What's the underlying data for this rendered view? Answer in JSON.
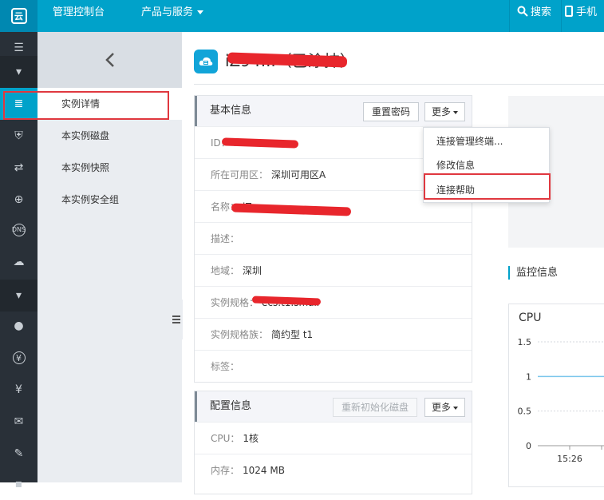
{
  "topbar": {
    "logo_text": "云",
    "console_label": "管理控制台",
    "products_label": "产品与服务",
    "search_label": "搜索",
    "phone_label": "手机",
    "bar_color": "#00a2ca"
  },
  "rail": {
    "items": [
      {
        "icon": "menu-icon",
        "glyph": "☰"
      },
      {
        "icon": "caret-down-icon",
        "glyph": "▾"
      },
      {
        "icon": "server-icon",
        "glyph": "≣"
      },
      {
        "icon": "shield-icon",
        "glyph": "⛨"
      },
      {
        "icon": "network-icon",
        "glyph": "⇄"
      },
      {
        "icon": "globe-icon",
        "glyph": "⊕"
      },
      {
        "icon": "dns-icon",
        "glyph": "DNS"
      },
      {
        "icon": "cloud-icon",
        "glyph": "☁"
      },
      {
        "icon": "caret-down-icon",
        "glyph": "▾"
      },
      {
        "icon": "user-icon",
        "glyph": "●"
      },
      {
        "icon": "yen-icon",
        "glyph": "¥"
      },
      {
        "icon": "money-bag-icon",
        "glyph": "¥"
      },
      {
        "icon": "mail-icon",
        "glyph": "✉"
      },
      {
        "icon": "pencil-icon",
        "glyph": "✎"
      },
      {
        "icon": "more-icon",
        "glyph": "▪"
      }
    ]
  },
  "subnav": {
    "back_glyph": "‹",
    "items": [
      {
        "label": "实例详情"
      },
      {
        "label": "本实例磁盘"
      },
      {
        "label": "本实例快照"
      },
      {
        "label": "本实例安全组"
      }
    ]
  },
  "header": {
    "title": "iZ94...（已涂抹）"
  },
  "basic_panel": {
    "title": "基本信息",
    "reset_password": "重置密码",
    "more": "更多",
    "rows": [
      {
        "label": "ID：",
        "value": "i-..."
      },
      {
        "label": "所在可用区：",
        "value": "深圳可用区A"
      },
      {
        "label": "名称：",
        "value": "iZ..."
      },
      {
        "label": "描述：",
        "value": ""
      },
      {
        "label": "地域：",
        "value": "深圳"
      },
      {
        "label": "实例规格：",
        "value": "ecs.t1.small"
      },
      {
        "label": "实例规格族：",
        "value": "简约型 t1"
      },
      {
        "label": "标签：",
        "value": ""
      }
    ]
  },
  "config_panel": {
    "title": "配置信息",
    "reinit_disk": "重新初始化磁盘",
    "more": "更多",
    "rows": [
      {
        "label": "CPU：",
        "value": "1核"
      },
      {
        "label": "内存：",
        "value": "1024 MB"
      }
    ]
  },
  "dropdown": {
    "items": [
      {
        "label": "连接管理终端..."
      },
      {
        "label": "修改信息"
      },
      {
        "label": "连接帮助"
      }
    ]
  },
  "monitor": {
    "title": "监控信息"
  },
  "chart_data": {
    "type": "line",
    "title": "CPU",
    "xlabel": "",
    "ylabel": "",
    "y_ticks": [
      "1.5",
      "1",
      "0.5",
      "0"
    ],
    "x_ticks": [
      "15:26"
    ],
    "ylim": [
      0,
      1.5
    ],
    "series": [
      {
        "values": [
          1,
          1
        ]
      }
    ]
  },
  "highlight_color": "#e0383f"
}
